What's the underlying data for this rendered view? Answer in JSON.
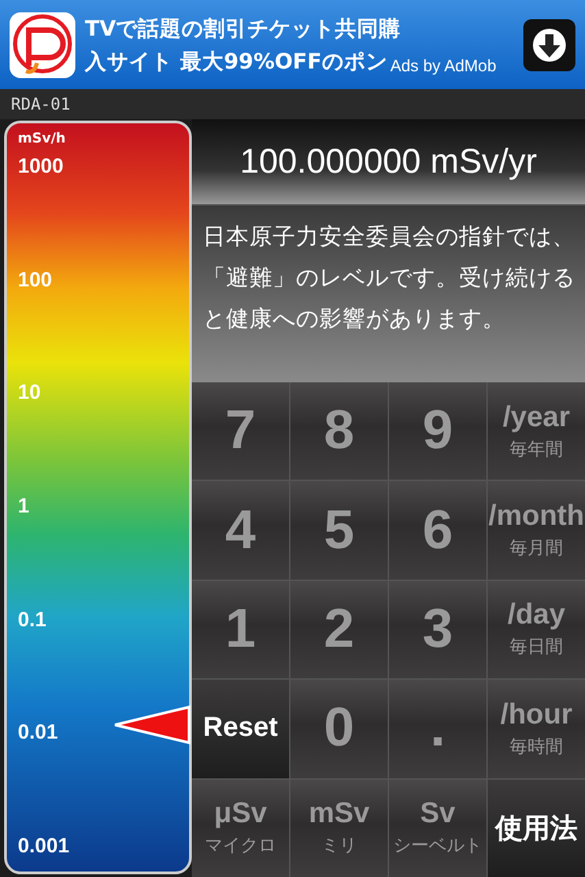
{
  "ad": {
    "lines": [
      "TVで話題の割引チケット共同購",
      "入サイト 最大99%OFFのポン"
    ],
    "attribution": "Ads by AdMob"
  },
  "status_bar": {
    "title": "RDA-01"
  },
  "scale": {
    "unit": "mSv/h",
    "labels": [
      "1000",
      "100",
      "10",
      "1",
      "0.1",
      "0.01",
      "0.001"
    ]
  },
  "display": {
    "value": "100.000000 mSv/yr"
  },
  "message": "日本原子力安全委員会の指針では、「避難」のレベルです。受け続けると健康への影響があります。",
  "keys": [
    {
      "kind": "digit",
      "label": "7"
    },
    {
      "kind": "digit",
      "label": "8"
    },
    {
      "kind": "digit",
      "label": "9"
    },
    {
      "kind": "unit",
      "label": "/year",
      "sub": "毎年間"
    },
    {
      "kind": "digit",
      "label": "4"
    },
    {
      "kind": "digit",
      "label": "5"
    },
    {
      "kind": "digit",
      "label": "6"
    },
    {
      "kind": "unit",
      "label": "/month",
      "sub": "毎月間"
    },
    {
      "kind": "digit",
      "label": "1"
    },
    {
      "kind": "digit",
      "label": "2"
    },
    {
      "kind": "digit",
      "label": "3"
    },
    {
      "kind": "unit",
      "label": "/day",
      "sub": "毎日間"
    },
    {
      "kind": "action",
      "label": "Reset"
    },
    {
      "kind": "digit",
      "label": "0"
    },
    {
      "kind": "dot",
      "label": "."
    },
    {
      "kind": "unit",
      "label": "/hour",
      "sub": "毎時間"
    },
    {
      "kind": "unit",
      "label": "μSv",
      "sub": "マイクロ"
    },
    {
      "kind": "unit",
      "label": "mSv",
      "sub": "ミリ"
    },
    {
      "kind": "unit",
      "label": "Sv",
      "sub": "シーベルト"
    },
    {
      "kind": "action",
      "label": "使用法"
    }
  ]
}
